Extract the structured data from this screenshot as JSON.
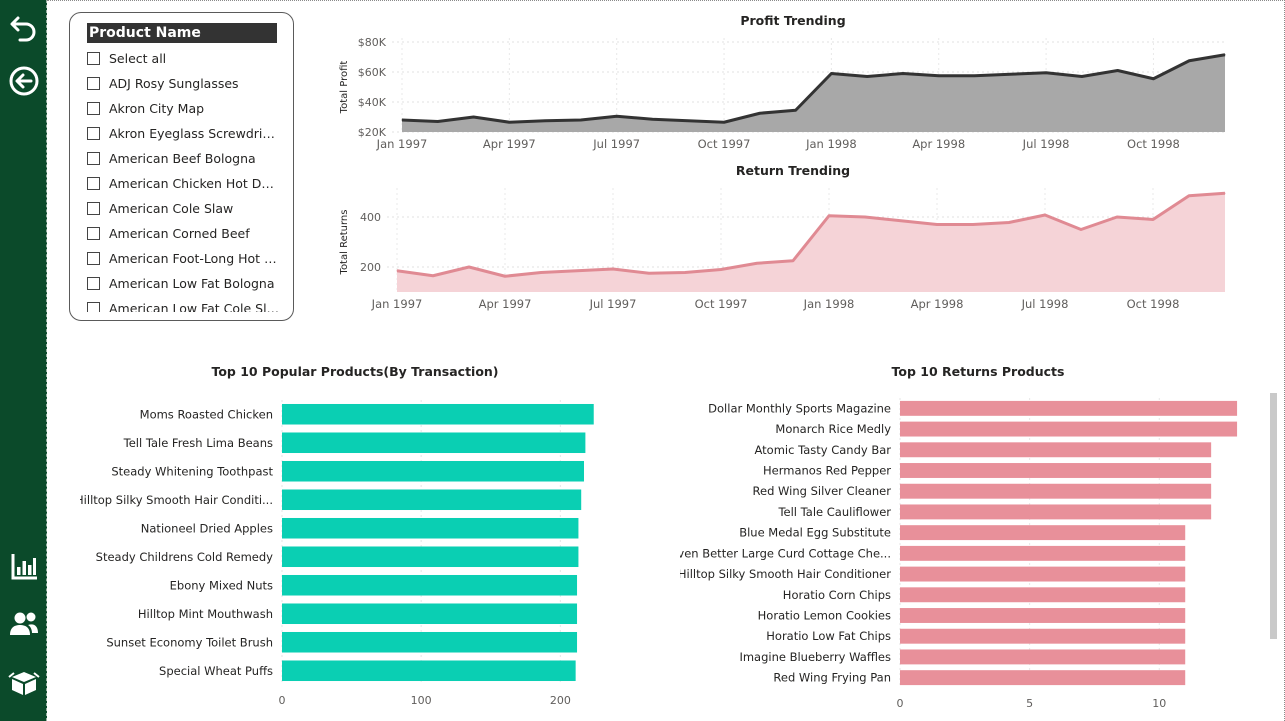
{
  "nav": {
    "icons": [
      "undo-icon",
      "back-circle-arrow-icon",
      "bar-chart-icon",
      "users-icon",
      "box-icon"
    ]
  },
  "slicer": {
    "title": "Product Name",
    "items": [
      "Select all",
      "ADJ Rosy Sunglasses",
      "Akron City Map",
      "Akron Eyeglass Screwdriver",
      "American Beef Bologna",
      "American Chicken Hot Dogs",
      "American Cole Slaw",
      "American Corned Beef",
      "American Foot-Long Hot Dogs",
      "American Low Fat Bologna",
      "American Low Fat Cole Slaw"
    ]
  },
  "colors": {
    "sidebar": "#0b4a2a",
    "profit_line": "#333333",
    "profit_area": "#a8a8a8",
    "return_line": "#e08a93",
    "return_area": "#f5d3d7",
    "popular_bar": "#0acfb3",
    "returns_bar": "#e8909a"
  },
  "chart_data": [
    {
      "type": "area",
      "title": "Profit Trending",
      "ylabel": "Total Profit",
      "xlabel": "",
      "x_start": "1997-01",
      "x_ticks": [
        "Jan 1997",
        "Apr 1997",
        "Jul 1997",
        "Oct 1997",
        "Jan 1998",
        "Apr 1998",
        "Jul 1998",
        "Oct 1998"
      ],
      "y_ticks": [
        "$20K",
        "$40K",
        "$60K",
        "$80K"
      ],
      "ylim": [
        20000,
        80000
      ],
      "values": [
        28000,
        27000,
        30000,
        26500,
        27500,
        28000,
        30500,
        28500,
        27500,
        26500,
        32500,
        34500,
        59000,
        57000,
        59000,
        57500,
        57500,
        58500,
        59500,
        57000,
        61000,
        55500,
        67500,
        71500
      ],
      "grid": true
    },
    {
      "type": "area",
      "title": "Return Trending",
      "ylabel": "Total Returns",
      "xlabel": "",
      "x_ticks": [
        "Jan 1997",
        "Apr 1997",
        "Jul 1997",
        "Oct 1997",
        "Jan 1998",
        "Apr 1998",
        "Jul 1998",
        "Oct 1998"
      ],
      "y_ticks": [
        "200",
        "400"
      ],
      "ylim": [
        100,
        500
      ],
      "values": [
        185,
        165,
        200,
        163,
        178,
        185,
        192,
        175,
        178,
        190,
        215,
        225,
        405,
        400,
        385,
        370,
        370,
        378,
        408,
        350,
        400,
        390,
        485,
        495
      ],
      "grid": true
    },
    {
      "type": "bar",
      "orientation": "horizontal",
      "title": "Top 10 Popular Products(By Transaction)",
      "categories": [
        "Moms Roasted Chicken",
        "Tell Tale Fresh Lima Beans",
        "Steady Whitening Toothpast",
        "Hilltop Silky Smooth Hair Conditi...",
        "Nationeel Dried Apples",
        "Steady Childrens Cold Remedy",
        "Ebony Mixed Nuts",
        "Hilltop Mint Mouthwash",
        "Sunset Economy Toilet Brush",
        "Special Wheat Puffs"
      ],
      "values": [
        224,
        218,
        217,
        215,
        213,
        213,
        212,
        212,
        212,
        211
      ],
      "xlim": [
        0,
        240
      ],
      "x_ticks": [
        "0",
        "100",
        "200"
      ],
      "grid": true
    },
    {
      "type": "bar",
      "orientation": "horizontal",
      "title": "Top 10 Returns Products",
      "categories": [
        "Dollar Monthly Sports Magazine",
        "Monarch Rice Medly",
        "Atomic Tasty Candy Bar",
        "Hermanos Red Pepper",
        "Red Wing Silver Cleaner",
        "Tell Tale Cauliflower",
        "Blue Medal Egg Substitute",
        "Even Better Large Curd Cottage Che...",
        "Hilltop Silky Smooth Hair Conditioner",
        "Horatio Corn Chips",
        "Horatio Lemon Cookies",
        "Horatio Low Fat Chips",
        "Imagine Blueberry Waffles",
        "Red Wing Frying Pan"
      ],
      "values": [
        13,
        13,
        12,
        12,
        12,
        12,
        11,
        11,
        11,
        11,
        11,
        11,
        11,
        11
      ],
      "xlim": [
        0,
        14
      ],
      "x_ticks": [
        "0",
        "5",
        "10"
      ],
      "grid": true
    }
  ]
}
